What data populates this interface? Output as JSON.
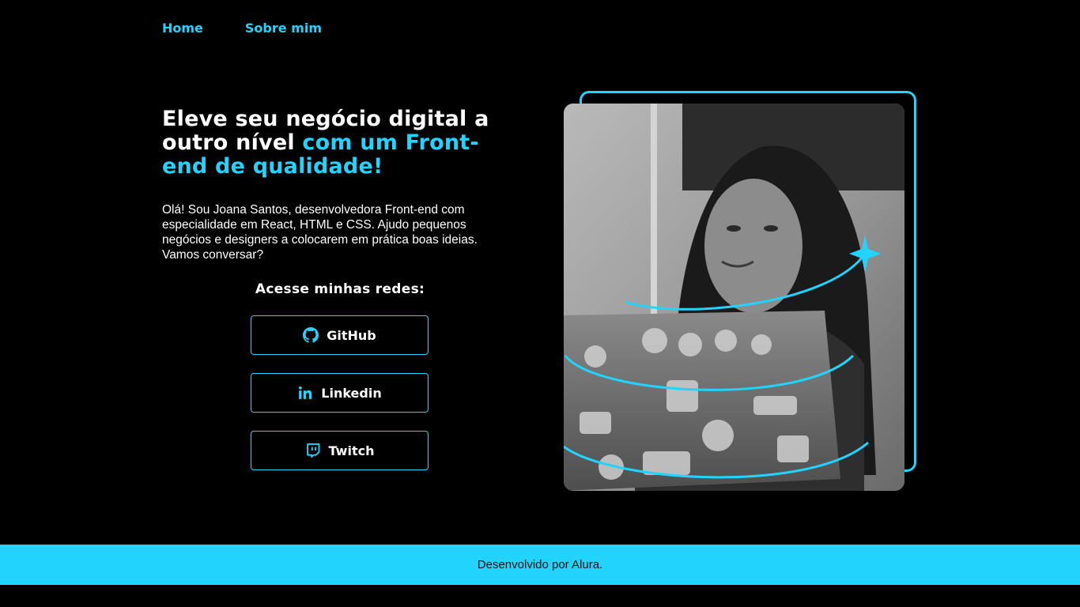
{
  "nav": {
    "home": "Home",
    "about": "Sobre mim"
  },
  "hero": {
    "headline_white": "Eleve seu negócio digital a outro nível ",
    "headline_accent": "com um Front-end de qualidade!",
    "intro": "Olá! Sou Joana Santos, desenvolvedora Front-end com especialidade em React, HTML e CSS. Ajudo pequenos negócios e designers a colocarem em prática boas ideias. Vamos conversar?"
  },
  "socials": {
    "title": "Acesse minhas redes:",
    "links": [
      {
        "label": "GitHub",
        "icon": "github-icon"
      },
      {
        "label": "Linkedin",
        "icon": "linkedin-icon"
      },
      {
        "label": "Twitch",
        "icon": "twitch-icon"
      }
    ]
  },
  "footer": {
    "text": "Desenvolvido por Alura."
  },
  "colors": {
    "accent": "#22d4fd",
    "background": "#000000",
    "text": "#ffffff"
  }
}
